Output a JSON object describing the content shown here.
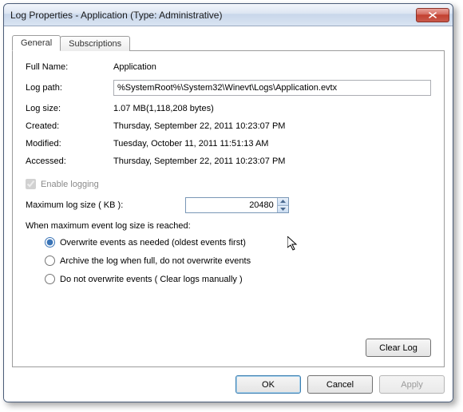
{
  "window": {
    "title": "Log Properties - Application (Type: Administrative)"
  },
  "tabs": {
    "general": "General",
    "subscriptions": "Subscriptions"
  },
  "fields": {
    "full_name_label": "Full Name:",
    "full_name_value": "Application",
    "log_path_label": "Log path:",
    "log_path_value": "%SystemRoot%\\System32\\Winevt\\Logs\\Application.evtx",
    "log_size_label": "Log size:",
    "log_size_value": "1.07 MB(1,118,208 bytes)",
    "created_label": "Created:",
    "created_value": "Thursday, September 22, 2011 10:23:07 PM",
    "modified_label": "Modified:",
    "modified_value": "Tuesday, October 11, 2011 11:51:13 AM",
    "accessed_label": "Accessed:",
    "accessed_value": "Thursday, September 22, 2011 10:23:07 PM"
  },
  "logging": {
    "enable_label": "Enable logging",
    "enable_checked": true,
    "max_size_label": "Maximum log size ( KB ):",
    "max_size_value": "20480",
    "when_label": "When maximum event log size is reached:",
    "radio_overwrite": "Overwrite events as needed (oldest events first)",
    "radio_archive": "Archive the log when full, do not overwrite events",
    "radio_noover": "Do not overwrite events ( Clear logs manually )",
    "selected": "overwrite"
  },
  "buttons": {
    "clear_log": "Clear Log",
    "ok": "OK",
    "cancel": "Cancel",
    "apply": "Apply"
  }
}
